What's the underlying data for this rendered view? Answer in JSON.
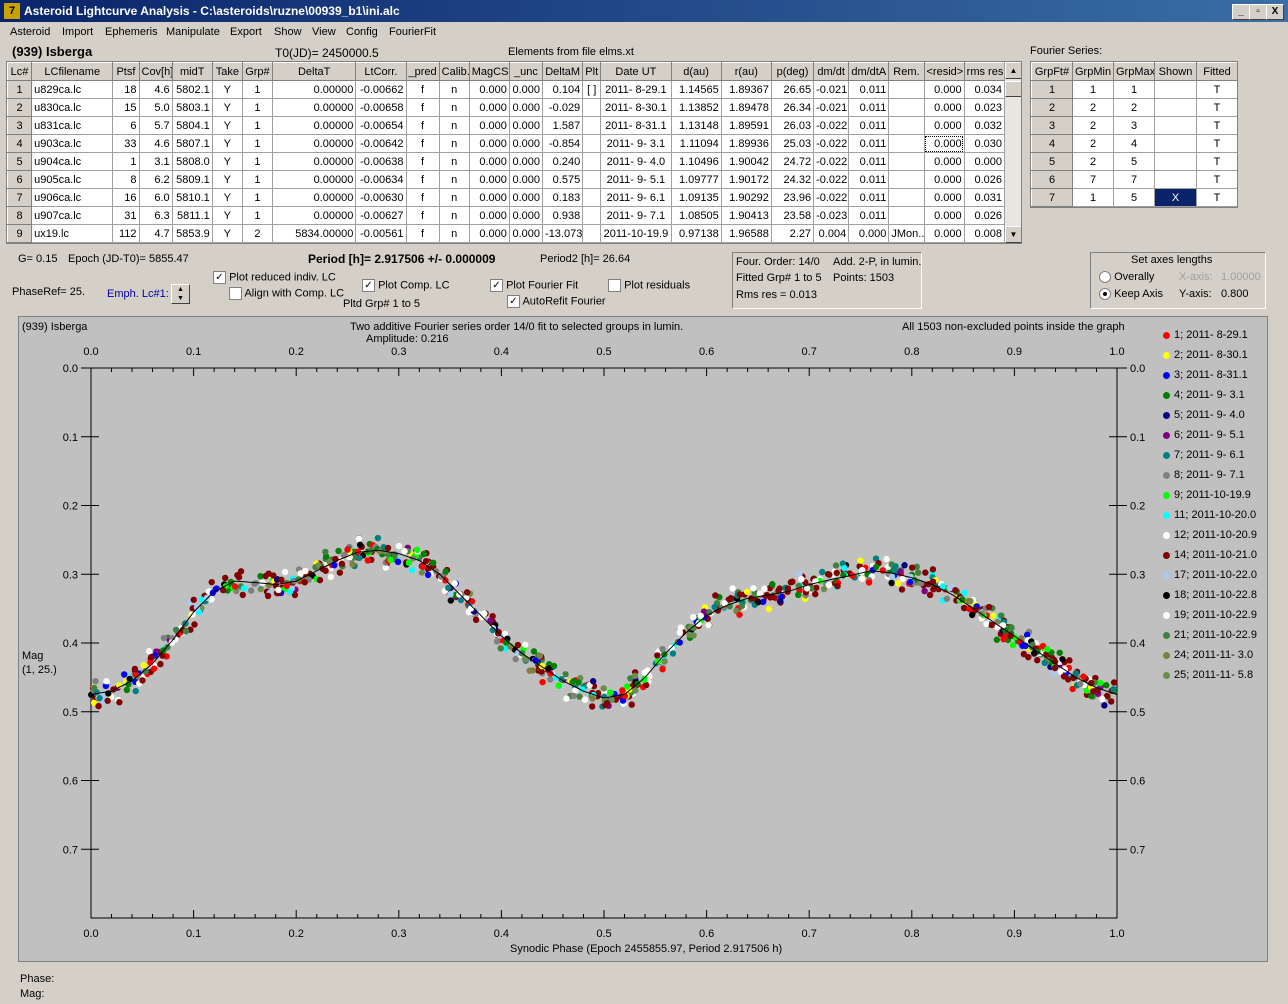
{
  "window": {
    "title": "Asteroid Lightcurve Analysis - C:\\asteroids\\ruzne\\00939_b1\\ini.alc",
    "minimize": "_",
    "restore": "▫",
    "close": "X"
  },
  "menu": [
    "Asteroid",
    "Import",
    "Ephemeris",
    "Manipulate",
    "Export",
    "Show",
    "View",
    "Config",
    "FourierFit"
  ],
  "header": {
    "asteroid_name": "(939) Isberga",
    "t0": "T0(JD)= 2450000.5",
    "elements": "Elements from file elms.xt",
    "fourier_series_label": "Fourier Series:"
  },
  "lc_table": {
    "columns": [
      "Lc#",
      "LCfilename",
      "Ptsf",
      "Cov[h]",
      "midT",
      "Take",
      "Grp#",
      "DeltaT",
      "LtCorr.",
      "_pred",
      "Calib.",
      "MagCS",
      "_unc",
      "DeltaM",
      "Plt",
      "Date UT",
      "d(au)",
      "r(au)",
      "p(deg)",
      "dm/dt",
      "dm/dtA",
      "Rem.",
      "<resid>",
      "rms res"
    ],
    "rows": [
      [
        "1",
        "u829ca.lc",
        "18",
        "4.6",
        "5802.1",
        "Y",
        "1",
        "0.00000",
        "-0.00662",
        "f",
        "n",
        "0.000",
        "0.000",
        "0.104",
        "[ ]",
        "2011- 8-29.1",
        "1.14565",
        "1.89367",
        "26.65",
        "-0.021",
        "0.011",
        "",
        "0.000",
        "0.034"
      ],
      [
        "2",
        "u830ca.lc",
        "15",
        "5.0",
        "5803.1",
        "Y",
        "1",
        "0.00000",
        "-0.00658",
        "f",
        "n",
        "0.000",
        "0.000",
        "-0.029",
        "",
        "2011- 8-30.1",
        "1.13852",
        "1.89478",
        "26.34",
        "-0.021",
        "0.011",
        "",
        "0.000",
        "0.023"
      ],
      [
        "3",
        "u831ca.lc",
        "6",
        "5.7",
        "5804.1",
        "Y",
        "1",
        "0.00000",
        "-0.00654",
        "f",
        "n",
        "0.000",
        "0.000",
        "1.587",
        "",
        "2011- 8-31.1",
        "1.13148",
        "1.89591",
        "26.03",
        "-0.022",
        "0.011",
        "",
        "0.000",
        "0.032"
      ],
      [
        "4",
        "u903ca.lc",
        "33",
        "4.6",
        "5807.1",
        "Y",
        "1",
        "0.00000",
        "-0.00642",
        "f",
        "n",
        "0.000",
        "0.000",
        "-0.854",
        "",
        "2011- 9- 3.1",
        "1.11094",
        "1.89936",
        "25.03",
        "-0.022",
        "0.011",
        "",
        "0.000",
        "0.030"
      ],
      [
        "5",
        "u904ca.lc",
        "1",
        "3.1",
        "5808.0",
        "Y",
        "1",
        "0.00000",
        "-0.00638",
        "f",
        "n",
        "0.000",
        "0.000",
        "0.240",
        "",
        "2011- 9- 4.0",
        "1.10496",
        "1.90042",
        "24.72",
        "-0.022",
        "0.011",
        "",
        "0.000",
        "0.000"
      ],
      [
        "6",
        "u905ca.lc",
        "8",
        "6.2",
        "5809.1",
        "Y",
        "1",
        "0.00000",
        "-0.00634",
        "f",
        "n",
        "0.000",
        "0.000",
        "0.575",
        "",
        "2011- 9- 5.1",
        "1.09777",
        "1.90172",
        "24.32",
        "-0.022",
        "0.011",
        "",
        "0.000",
        "0.026"
      ],
      [
        "7",
        "u906ca.lc",
        "16",
        "6.0",
        "5810.1",
        "Y",
        "1",
        "0.00000",
        "-0.00630",
        "f",
        "n",
        "0.000",
        "0.000",
        "0.183",
        "",
        "2011- 9- 6.1",
        "1.09135",
        "1.90292",
        "23.96",
        "-0.022",
        "0.011",
        "",
        "0.000",
        "0.031"
      ],
      [
        "8",
        "u907ca.lc",
        "31",
        "6.3",
        "5811.1",
        "Y",
        "1",
        "0.00000",
        "-0.00627",
        "f",
        "n",
        "0.000",
        "0.000",
        "0.938",
        "",
        "2011- 9- 7.1",
        "1.08505",
        "1.90413",
        "23.58",
        "-0.023",
        "0.011",
        "",
        "0.000",
        "0.026"
      ],
      [
        "9",
        "ux19.lc",
        "112",
        "4.7",
        "5853.9",
        "Y",
        "2",
        "5834.00000",
        "-0.00561",
        "f",
        "n",
        "0.000",
        "0.000",
        "-13.073",
        "",
        "2011-10-19.9",
        "0.97138",
        "1.96588",
        "2.27",
        "0.004",
        "0.000",
        "JMon...",
        "0.000",
        "0.008"
      ]
    ]
  },
  "fourier_table": {
    "columns": [
      "GrpFt#",
      "GrpMin",
      "GrpMax",
      "Shown",
      "Fitted"
    ],
    "rows": [
      [
        "1",
        "1",
        "1",
        "",
        "T"
      ],
      [
        "2",
        "2",
        "2",
        "",
        "T"
      ],
      [
        "3",
        "2",
        "3",
        "",
        "T"
      ],
      [
        "4",
        "2",
        "4",
        "",
        "T"
      ],
      [
        "5",
        "2",
        "5",
        "",
        "T"
      ],
      [
        "6",
        "7",
        "7",
        "",
        "T"
      ],
      [
        "7",
        "1",
        "5",
        "X",
        "T"
      ]
    ]
  },
  "params": {
    "g": "G= 0.15",
    "epoch": "Epoch (JD-T0)= 5855.47",
    "period": "Period [h]= 2.917506 +/- 0.000009",
    "period2": "Period2 [h]= 26.64",
    "phase_ref": "PhaseRef= 25.",
    "emph_lc": "Emph. Lc#1:",
    "pltd_grp": "Pltd Grp#  1   to   5"
  },
  "checkboxes": {
    "plot_reduced": {
      "label": "Plot reduced indiv. LC",
      "checked": true
    },
    "align_comp": {
      "label": "Align with Comp. LC",
      "checked": false
    },
    "plot_comp": {
      "label": "Plot Comp. LC",
      "checked": true
    },
    "plot_fourier": {
      "label": "Plot Fourier Fit",
      "checked": true
    },
    "autorefit": {
      "label": "AutoRefit Fourier",
      "checked": true
    },
    "plot_residuals": {
      "label": "Plot residuals",
      "checked": false
    }
  },
  "fit_info": {
    "line1a": "Four. Order: 14/0",
    "line1b": "Add. 2-P, in lumin.",
    "line2a": "Fitted Grp# 1 to 5",
    "line2b": "Points: 1503",
    "line3": "Rms res     = 0.013"
  },
  "axes_box": {
    "title": "Set axes lengths",
    "overally": "Overally",
    "keep_axis": "Keep Axis",
    "selected": "keep_axis",
    "xaxis_label": "X-axis:",
    "xaxis_value": "1.00000",
    "yaxis_label": "Y-axis:",
    "yaxis_value": "0.800"
  },
  "plot": {
    "asteroid": "(939) Isberga",
    "subtitle": "Two additive Fourier series order 14/0 fit to selected groups in lumin.",
    "amplitude": "Amplitude: 0.216",
    "points_note": "All 1503 non-excluded points inside the graph",
    "ylabel": "Mag",
    "ylabel2": "(1, 25.)",
    "xlabel": "Synodic Phase (Epoch 2455855.97, Period 2.917506 h)"
  },
  "chart_data": {
    "type": "scatter",
    "title": "Two additive Fourier series order 14/0 fit to selected groups in lumin.",
    "xlabel": "Synodic Phase (Epoch 2455855.97, Period 2.917506 h)",
    "ylabel": "Mag (1, 25.)",
    "xlim": [
      0.0,
      1.0
    ],
    "ylim": [
      0.0,
      0.8
    ],
    "y_inverted": true,
    "x_ticks": [
      "0.0",
      "0.1",
      "0.2",
      "0.3",
      "0.4",
      "0.5",
      "0.6",
      "0.7",
      "0.8",
      "0.9",
      "1.0"
    ],
    "y_ticks": [
      "0.0",
      "0.1",
      "0.2",
      "0.3",
      "0.4",
      "0.5",
      "0.6",
      "0.7"
    ],
    "fit_curve": {
      "x": [
        0.0,
        0.02,
        0.04,
        0.06,
        0.08,
        0.1,
        0.12,
        0.14,
        0.16,
        0.18,
        0.2,
        0.22,
        0.24,
        0.26,
        0.28,
        0.3,
        0.32,
        0.34,
        0.36,
        0.38,
        0.4,
        0.42,
        0.44,
        0.46,
        0.48,
        0.5,
        0.52,
        0.54,
        0.56,
        0.58,
        0.6,
        0.62,
        0.64,
        0.66,
        0.68,
        0.7,
        0.72,
        0.74,
        0.76,
        0.78,
        0.8,
        0.82,
        0.84,
        0.86,
        0.88,
        0.9,
        0.92,
        0.94,
        0.96,
        0.98,
        1.0
      ],
      "y": [
        0.475,
        0.47,
        0.455,
        0.43,
        0.395,
        0.355,
        0.325,
        0.31,
        0.312,
        0.315,
        0.31,
        0.295,
        0.28,
        0.268,
        0.265,
        0.27,
        0.28,
        0.3,
        0.33,
        0.36,
        0.39,
        0.415,
        0.435,
        0.455,
        0.47,
        0.48,
        0.475,
        0.45,
        0.415,
        0.385,
        0.36,
        0.345,
        0.335,
        0.33,
        0.325,
        0.315,
        0.308,
        0.302,
        0.295,
        0.298,
        0.305,
        0.315,
        0.33,
        0.35,
        0.37,
        0.39,
        0.41,
        0.43,
        0.45,
        0.465,
        0.475
      ]
    },
    "series": [
      {
        "name": "1; 2011- 8-29.1",
        "color": "#ff0000"
      },
      {
        "name": "2; 2011- 8-30.1",
        "color": "#ffff00"
      },
      {
        "name": "3; 2011- 8-31.1",
        "color": "#0000ff"
      },
      {
        "name": "4; 2011- 9- 3.1",
        "color": "#008000"
      },
      {
        "name": "5; 2011- 9- 4.0",
        "color": "#000080"
      },
      {
        "name": "6; 2011- 9- 5.1",
        "color": "#800080"
      },
      {
        "name": "7; 2011- 9- 6.1",
        "color": "#008080"
      },
      {
        "name": "8; 2011- 9- 7.1",
        "color": "#808080"
      },
      {
        "name": "9; 2011-10-19.9",
        "color": "#00ff00"
      },
      {
        "name": "11; 2011-10-20.0",
        "color": "#00ffff"
      },
      {
        "name": "12; 2011-10-20.9",
        "color": "#ffffff"
      },
      {
        "name": "14; 2011-10-21.0",
        "color": "#800000"
      },
      {
        "name": "17; 2011-10-22.0",
        "color": "#a6caf0"
      },
      {
        "name": "18; 2011-10-22.8",
        "color": "#000000"
      },
      {
        "name": "19; 2011-10-22.9",
        "color": "#fffbf0"
      },
      {
        "name": "21; 2011-10-22.9",
        "color": "#408040"
      },
      {
        "name": "24; 2011-11- 3.0",
        "color": "#808040"
      },
      {
        "name": "25; 2011-11- 5.8",
        "color": "#6b8e4e"
      }
    ],
    "point_count": 1503
  },
  "status": {
    "phase": "Phase:",
    "mag": "Mag:"
  }
}
